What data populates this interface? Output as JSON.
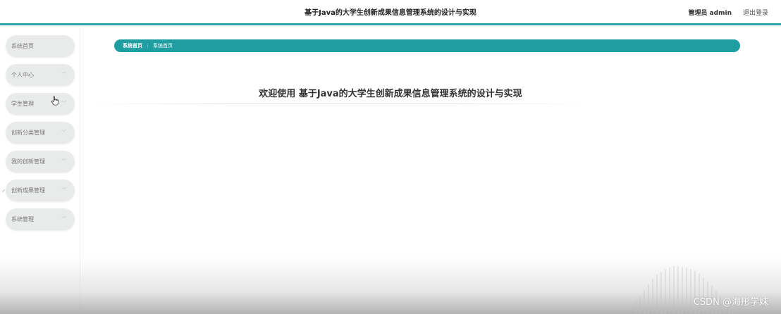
{
  "header": {
    "title": "基于Java的大学生创新成果信息管理系统的设计与实现",
    "user": "管理员 admin",
    "logout": "退出登录"
  },
  "sidebar": {
    "items": [
      {
        "label": "系统首页",
        "has_arrow": false
      },
      {
        "label": "个人中心",
        "has_arrow": true
      },
      {
        "label": "学生管理",
        "has_arrow": true
      },
      {
        "label": "创新分类管理",
        "has_arrow": true
      },
      {
        "label": "我的创新管理",
        "has_arrow": true
      },
      {
        "label": "创新成果管理",
        "has_arrow": true
      },
      {
        "label": "系统管理",
        "has_arrow": true
      }
    ],
    "arrow_glyph": "﹀"
  },
  "breadcrumb": {
    "home": "系统首页",
    "separator": "⋮",
    "current": "系统首页"
  },
  "main": {
    "welcome": "欢迎使用 基于Java的大学生创新成果信息管理系统的设计与实现"
  },
  "watermark": "CSDN @海彤学妹",
  "colors": {
    "accent": "#1f9ea2",
    "header_border": "#2aa5a8",
    "menu_bg": "#e9eaea"
  }
}
